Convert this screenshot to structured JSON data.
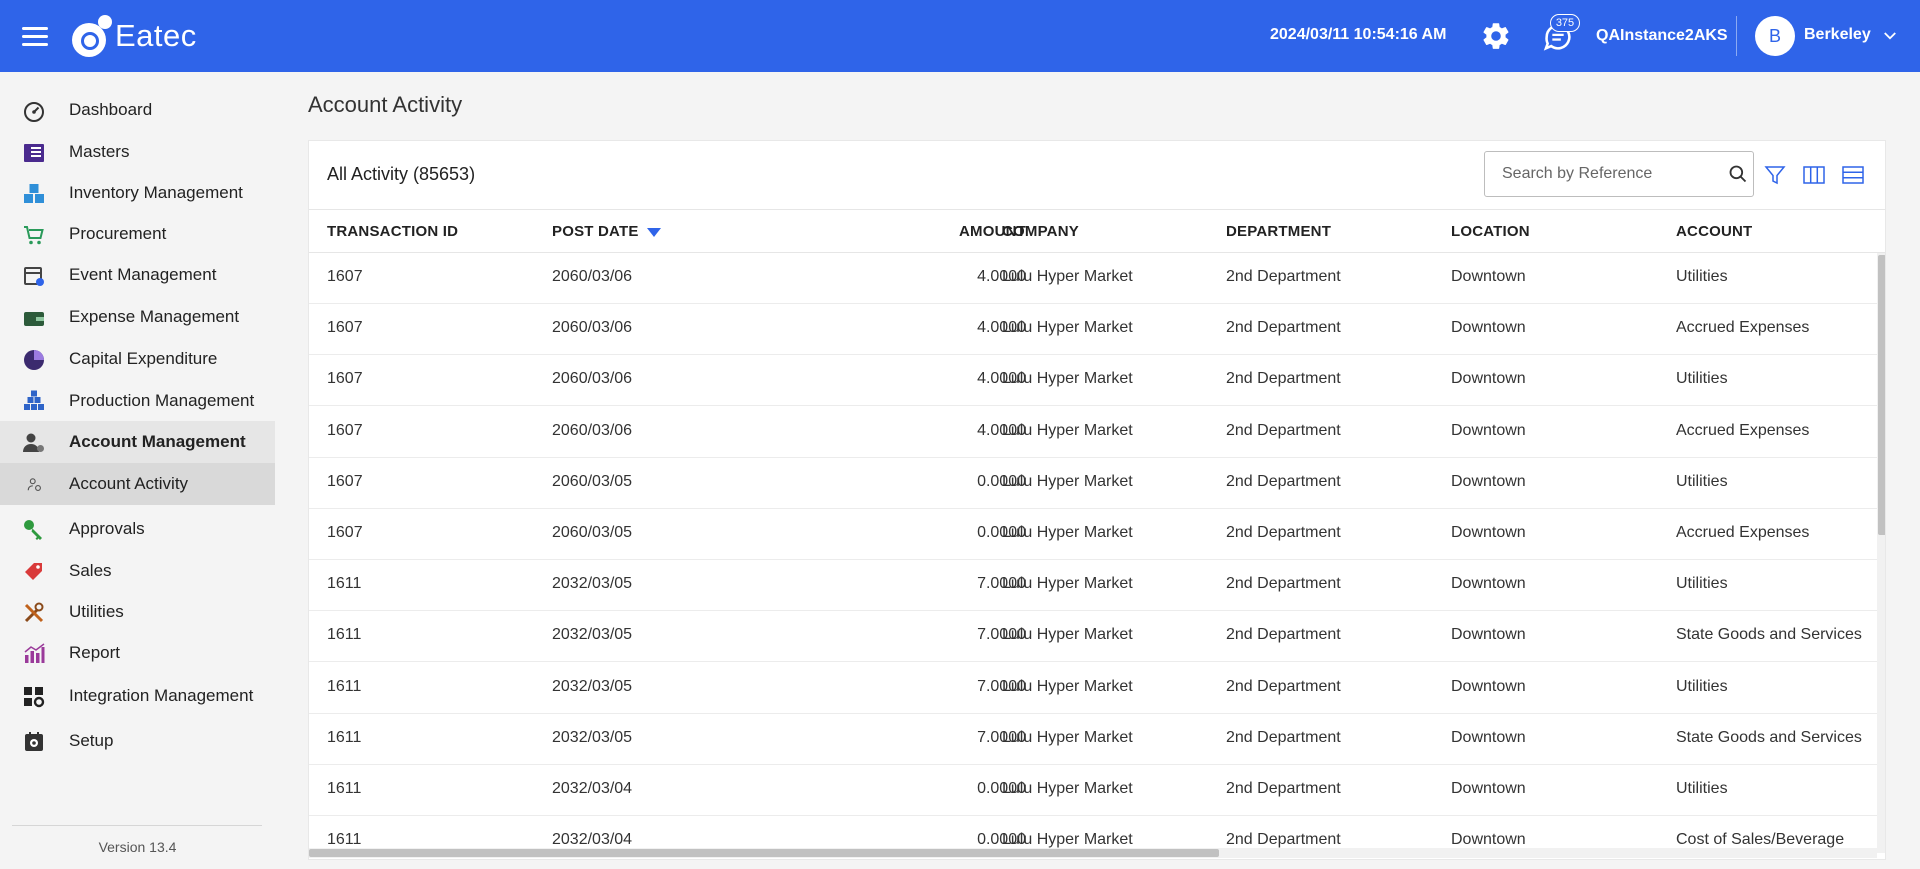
{
  "header": {
    "app_name": "Eatec",
    "datetime": "2024/03/11 10:54:16 AM",
    "notification_count": "375",
    "instance": "QAInstance2AKS",
    "user_initial": "B",
    "user_name": "Berkeley",
    "brand_color": "#2f64e9"
  },
  "sidebar": {
    "items": [
      {
        "label": "Dashboard",
        "icon": "gauge-icon"
      },
      {
        "label": "Masters",
        "icon": "book-icon"
      },
      {
        "label": "Inventory Management",
        "icon": "boxes-icon"
      },
      {
        "label": "Procurement",
        "icon": "cart-icon"
      },
      {
        "label": "Event Management",
        "icon": "calendar-icon"
      },
      {
        "label": "Expense Management",
        "icon": "wallet-icon"
      },
      {
        "label": "Capital Expenditure",
        "icon": "pie-chart-icon"
      },
      {
        "label": "Production Management",
        "icon": "blocks-icon"
      },
      {
        "label": "Account Management",
        "icon": "user-gear-icon"
      },
      {
        "label": "Account Activity",
        "icon": "activity-icon"
      },
      {
        "label": "Approvals",
        "icon": "key-icon"
      },
      {
        "label": "Sales",
        "icon": "tag-icon"
      },
      {
        "label": "Utilities",
        "icon": "tools-icon"
      },
      {
        "label": "Report",
        "icon": "bar-chart-icon"
      },
      {
        "label": "Integration Management",
        "icon": "grid-gear-icon"
      },
      {
        "label": "Setup",
        "icon": "setup-icon"
      }
    ],
    "version": "Version 13.4"
  },
  "main": {
    "title": "Account Activity",
    "card_title": "All Activity (85653)",
    "search_placeholder": "Search by Reference",
    "columns": [
      "TRANSACTION ID",
      "POST DATE",
      "AMOUNT",
      "COMPANY",
      "DEPARTMENT",
      "LOCATION",
      "ACCOUNT"
    ],
    "sort_column": "POST DATE",
    "sort_direction": "descending",
    "rows": [
      [
        "1607",
        "2060/03/06",
        "4.0000",
        "Lulu Hyper Market",
        "2nd Department",
        "Downtown",
        "Utilities"
      ],
      [
        "1607",
        "2060/03/06",
        "4.0000",
        "Lulu Hyper Market",
        "2nd Department",
        "Downtown",
        "Accrued Expenses"
      ],
      [
        "1607",
        "2060/03/06",
        "4.0000",
        "Lulu Hyper Market",
        "2nd Department",
        "Downtown",
        "Utilities"
      ],
      [
        "1607",
        "2060/03/06",
        "4.0000",
        "Lulu Hyper Market",
        "2nd Department",
        "Downtown",
        "Accrued Expenses"
      ],
      [
        "1607",
        "2060/03/05",
        "0.0000",
        "Lulu Hyper Market",
        "2nd Department",
        "Downtown",
        "Utilities"
      ],
      [
        "1607",
        "2060/03/05",
        "0.0000",
        "Lulu Hyper Market",
        "2nd Department",
        "Downtown",
        "Accrued Expenses"
      ],
      [
        "1611",
        "2032/03/05",
        "7.0000",
        "Lulu Hyper Market",
        "2nd Department",
        "Downtown",
        "Utilities"
      ],
      [
        "1611",
        "2032/03/05",
        "7.0000",
        "Lulu Hyper Market",
        "2nd Department",
        "Downtown",
        "State Goods and Services"
      ],
      [
        "1611",
        "2032/03/05",
        "7.0000",
        "Lulu Hyper Market",
        "2nd Department",
        "Downtown",
        "Utilities"
      ],
      [
        "1611",
        "2032/03/05",
        "7.0000",
        "Lulu Hyper Market",
        "2nd Department",
        "Downtown",
        "State Goods and Services"
      ],
      [
        "1611",
        "2032/03/04",
        "0.0000",
        "Lulu Hyper Market",
        "2nd Department",
        "Downtown",
        "Utilities"
      ],
      [
        "1611",
        "2032/03/04",
        "0.0000",
        "Lulu Hyper Market",
        "2nd Department",
        "Downtown",
        "Cost of Sales/Beverage"
      ]
    ]
  }
}
